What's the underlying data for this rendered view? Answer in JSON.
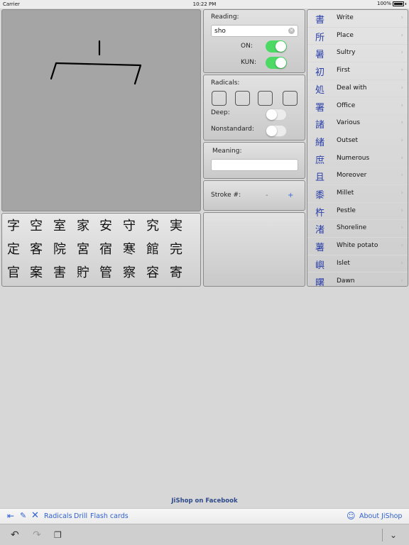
{
  "status_bar": {
    "carrier": "Carrier",
    "time": "10:22 PM",
    "battery": "100%"
  },
  "reading_panel": {
    "title": "Reading:",
    "value": "sho",
    "on_label": "ON:",
    "kun_label": "KUN:",
    "on_enabled": true,
    "kun_enabled": true
  },
  "radicals_panel": {
    "title": "Radicals:",
    "deep_label": "Deep:",
    "nonstandard_label": "Nonstandard:",
    "deep_enabled": false,
    "nonstandard_enabled": false
  },
  "meaning_panel": {
    "title": "Meaning:",
    "value": ""
  },
  "stroke_panel": {
    "title": "Stroke #:",
    "minus": "-",
    "plus": "+"
  },
  "kanji_grid": {
    "rows": [
      [
        "字",
        "空",
        "室",
        "家",
        "安",
        "守",
        "究",
        "実"
      ],
      [
        "定",
        "客",
        "院",
        "宮",
        "宿",
        "寒",
        "館",
        "完"
      ],
      [
        "官",
        "案",
        "害",
        "貯",
        "管",
        "察",
        "容",
        "寄"
      ]
    ]
  },
  "results": [
    {
      "kanji": "書",
      "meaning": "Write"
    },
    {
      "kanji": "所",
      "meaning": "Place"
    },
    {
      "kanji": "暑",
      "meaning": "Sultry"
    },
    {
      "kanji": "初",
      "meaning": "First"
    },
    {
      "kanji": "処",
      "meaning": "Deal with"
    },
    {
      "kanji": "署",
      "meaning": "Office"
    },
    {
      "kanji": "諸",
      "meaning": "Various"
    },
    {
      "kanji": "緒",
      "meaning": "Outset"
    },
    {
      "kanji": "庶",
      "meaning": "Numerous"
    },
    {
      "kanji": "且",
      "meaning": "Moreover"
    },
    {
      "kanji": "黍",
      "meaning": "Millet"
    },
    {
      "kanji": "杵",
      "meaning": "Pestle"
    },
    {
      "kanji": "渚",
      "meaning": "Shoreline"
    },
    {
      "kanji": "薯",
      "meaning": "White potato"
    },
    {
      "kanji": "嶼",
      "meaning": "Islet"
    },
    {
      "kanji": "曙",
      "meaning": "Dawn"
    }
  ],
  "facebook_link": "JiShop on Facebook",
  "toolbar": {
    "radicals": "Radicals",
    "drill": "Drill",
    "flash_cards": "Flash cards",
    "about": "About JiShop"
  },
  "colors": {
    "accent": "#3060d0",
    "toggle_on": "#4cd964",
    "kanji_result": "#2b3fa8",
    "drawing_bg": "#a5a5a5"
  }
}
